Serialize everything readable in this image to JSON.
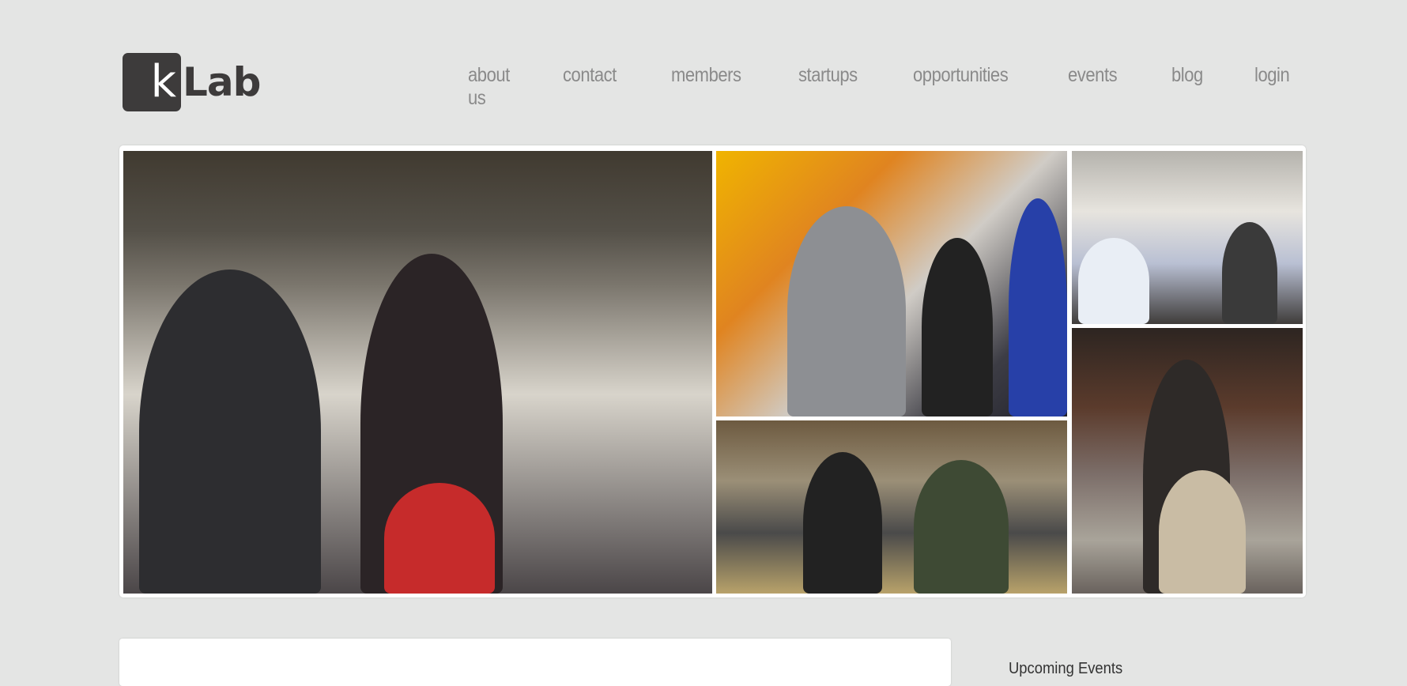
{
  "logo": {
    "mark": "k",
    "text": "Lab"
  },
  "nav": {
    "items": [
      "about us",
      "contact",
      "members",
      "startups",
      "opportunities",
      "events",
      "blog",
      "login"
    ]
  },
  "slider": {
    "photos": [
      "photo-officials-tour",
      "photo-audience-seated",
      "photo-workspace-group",
      "photo-presentation-room",
      "photo-speaker-microphone"
    ]
  },
  "sidebar": {
    "heading": "Upcoming Events"
  },
  "colors": {
    "background": "#e4e5e4",
    "nav_text": "#8a8a8a",
    "logo": "#3d3b3b"
  }
}
